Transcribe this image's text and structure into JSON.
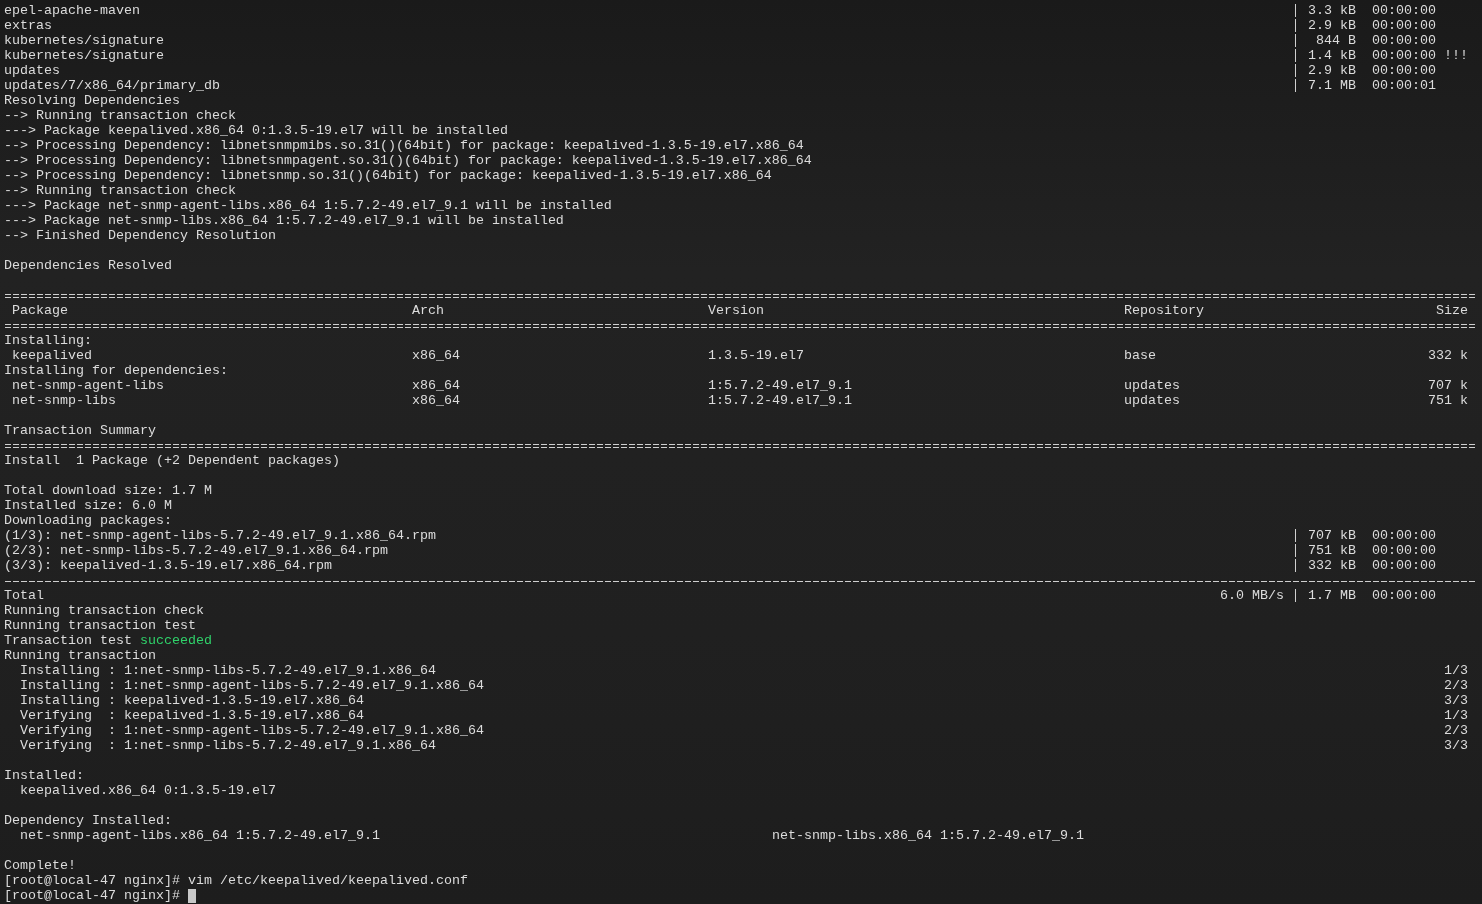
{
  "terminal": {
    "lines": [
      {
        "kind": "download",
        "name": "epel-apache-maven",
        "size": "3.3 kB",
        "time": "00:00:00"
      },
      {
        "kind": "download",
        "name": "extras",
        "size": "2.9 kB",
        "time": "00:00:00"
      },
      {
        "kind": "download",
        "name": "kubernetes/signature",
        "size": "844 B",
        "time": "00:00:00"
      },
      {
        "kind": "download",
        "name": "kubernetes/signature",
        "size": "1.4 kB",
        "time": "00:00:00",
        "note": "!!!"
      },
      {
        "kind": "download",
        "name": "updates",
        "size": "2.9 kB",
        "time": "00:00:00"
      },
      {
        "kind": "download",
        "name": "updates/7/x86_64/primary_db",
        "size": "7.1 MB",
        "time": "00:00:01"
      },
      {
        "kind": "text",
        "text": "Resolving Dependencies"
      },
      {
        "kind": "text",
        "text": "--> Running transaction check"
      },
      {
        "kind": "text",
        "text": "---> Package keepalived.x86_64 0:1.3.5-19.el7 will be installed"
      },
      {
        "kind": "text",
        "text": "--> Processing Dependency: libnetsnmpmibs.so.31()(64bit) for package: keepalived-1.3.5-19.el7.x86_64"
      },
      {
        "kind": "text",
        "text": "--> Processing Dependency: libnetsnmpagent.so.31()(64bit) for package: keepalived-1.3.5-19.el7.x86_64"
      },
      {
        "kind": "text",
        "text": "--> Processing Dependency: libnetsnmp.so.31()(64bit) for package: keepalived-1.3.5-19.el7.x86_64"
      },
      {
        "kind": "text",
        "text": "--> Running transaction check"
      },
      {
        "kind": "text",
        "text": "---> Package net-snmp-agent-libs.x86_64 1:5.7.2-49.el7_9.1 will be installed"
      },
      {
        "kind": "text",
        "text": "---> Package net-snmp-libs.x86_64 1:5.7.2-49.el7_9.1 will be installed"
      },
      {
        "kind": "text",
        "text": "--> Finished Dependency Resolution"
      },
      {
        "kind": "blank"
      },
      {
        "kind": "text",
        "text": "Dependencies Resolved"
      },
      {
        "kind": "blank"
      },
      {
        "kind": "double_rule"
      },
      {
        "kind": "table_header",
        "columns": [
          "Package",
          "Arch",
          "Version",
          "Repository",
          "Size"
        ]
      },
      {
        "kind": "double_rule"
      },
      {
        "kind": "text",
        "text": "Installing:"
      },
      {
        "kind": "package",
        "cells": [
          "keepalived",
          "x86_64",
          "1.3.5-19.el7",
          "base",
          "332 k"
        ]
      },
      {
        "kind": "text",
        "text": "Installing for dependencies:"
      },
      {
        "kind": "package",
        "cells": [
          "net-snmp-agent-libs",
          "x86_64",
          "1:5.7.2-49.el7_9.1",
          "updates",
          "707 k"
        ]
      },
      {
        "kind": "package",
        "cells": [
          "net-snmp-libs",
          "x86_64",
          "1:5.7.2-49.el7_9.1",
          "updates",
          "751 k"
        ]
      },
      {
        "kind": "blank"
      },
      {
        "kind": "text",
        "text": "Transaction Summary"
      },
      {
        "kind": "double_rule"
      },
      {
        "kind": "text",
        "text": "Install  1 Package (+2 Dependent packages)"
      },
      {
        "kind": "blank"
      },
      {
        "kind": "text",
        "text": "Total download size: 1.7 M"
      },
      {
        "kind": "text",
        "text": "Installed size: 6.0 M"
      },
      {
        "kind": "text",
        "text": "Downloading packages:"
      },
      {
        "kind": "download",
        "name": "(1/3): net-snmp-agent-libs-5.7.2-49.el7_9.1.x86_64.rpm",
        "size": "707 kB",
        "time": "00:00:00"
      },
      {
        "kind": "download",
        "name": "(2/3): net-snmp-libs-5.7.2-49.el7_9.1.x86_64.rpm",
        "size": "751 kB",
        "time": "00:00:00"
      },
      {
        "kind": "download",
        "name": "(3/3): keepalived-1.3.5-19.el7.x86_64.rpm",
        "size": "332 kB",
        "time": "00:00:00"
      },
      {
        "kind": "single_rule"
      },
      {
        "kind": "total",
        "label": "Total",
        "speed": "6.0 MB/s",
        "size": "1.7 MB",
        "time": "00:00:00"
      },
      {
        "kind": "text",
        "text": "Running transaction check"
      },
      {
        "kind": "text",
        "text": "Running transaction test"
      },
      {
        "kind": "result",
        "text": "Transaction test",
        "result": "succeeded"
      },
      {
        "kind": "text",
        "text": "Running transaction"
      },
      {
        "kind": "step",
        "text": "Installing : 1:net-snmp-libs-5.7.2-49.el7_9.1.x86_64",
        "count": "1/3"
      },
      {
        "kind": "step",
        "text": "Installing : 1:net-snmp-agent-libs-5.7.2-49.el7_9.1.x86_64",
        "count": "2/3"
      },
      {
        "kind": "step",
        "text": "Installing : keepalived-1.3.5-19.el7.x86_64",
        "count": "3/3"
      },
      {
        "kind": "step",
        "text": "Verifying  : keepalived-1.3.5-19.el7.x86_64",
        "count": "1/3"
      },
      {
        "kind": "step",
        "text": "Verifying  : 1:net-snmp-agent-libs-5.7.2-49.el7_9.1.x86_64",
        "count": "2/3"
      },
      {
        "kind": "step",
        "text": "Verifying  : 1:net-snmp-libs-5.7.2-49.el7_9.1.x86_64",
        "count": "3/3"
      },
      {
        "kind": "blank"
      },
      {
        "kind": "text",
        "text": "Installed:"
      },
      {
        "kind": "items",
        "items": [
          "keepalived.x86_64 0:1.3.5-19.el7"
        ]
      },
      {
        "kind": "blank"
      },
      {
        "kind": "text",
        "text": "Dependency Installed:"
      },
      {
        "kind": "items",
        "items": [
          "net-snmp-agent-libs.x86_64 1:5.7.2-49.el7_9.1",
          "net-snmp-libs.x86_64 1:5.7.2-49.el7_9.1"
        ]
      },
      {
        "kind": "blank"
      },
      {
        "kind": "text",
        "text": "Complete!"
      },
      {
        "kind": "prompt",
        "prompt": "[root@local-47 nginx]#",
        "command": "vim /etc/keepalived/keepalived.conf"
      },
      {
        "kind": "prompt",
        "prompt": "[root@local-47 nginx]#",
        "cursor": true
      }
    ]
  }
}
